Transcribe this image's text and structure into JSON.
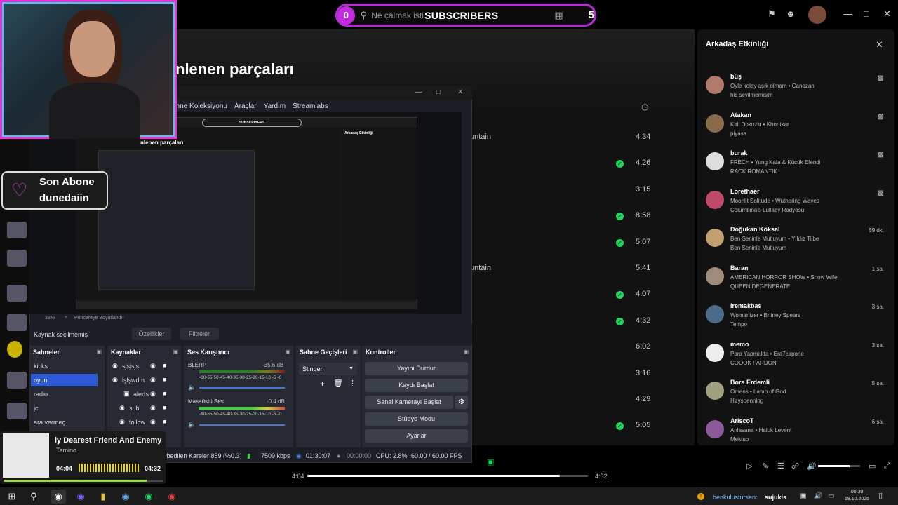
{
  "topbar": {
    "sub_count": "0",
    "search_placeholder": "Ne çalmak istiyor",
    "subscribers_label": "SUBSCRIBERS",
    "subscriber_goal": "5"
  },
  "main": {
    "page_title": "nlenen parçaları",
    "tracks": [
      {
        "title": "untain",
        "duration": "4:34",
        "saved": false
      },
      {
        "title": "",
        "duration": "4:26",
        "saved": true
      },
      {
        "title": "",
        "duration": "3:15",
        "saved": false
      },
      {
        "title": "",
        "duration": "8:58",
        "saved": true
      },
      {
        "title": "",
        "duration": "5:07",
        "saved": true
      },
      {
        "title": "untain",
        "duration": "5:41",
        "saved": false
      },
      {
        "title": "",
        "duration": "4:07",
        "saved": true
      },
      {
        "title": "",
        "duration": "4:32",
        "saved": true
      },
      {
        "title": "",
        "duration": "6:02",
        "saved": false
      },
      {
        "title": "",
        "duration": "3:16",
        "saved": false
      },
      {
        "title": "",
        "duration": "4:29",
        "saved": false
      },
      {
        "title": "",
        "duration": "5:05",
        "saved": true
      }
    ]
  },
  "friends": {
    "title": "Arkadaş Etkinliği",
    "items": [
      {
        "name": "büş",
        "song": "Öyle kolay aşık olmam • Canozan",
        "playlist": "hic sevilmemisim",
        "time": "",
        "color": "#b07a6a"
      },
      {
        "name": "Atakan",
        "song": "Kirli Dokuzlu • Khontkar",
        "playlist": "piyasa",
        "time": "",
        "color": "#8a6a4a"
      },
      {
        "name": "burak",
        "song": "FRECH • Yung Kafa & Kücük Efendi",
        "playlist": "RACK ROMANTIK",
        "time": "",
        "color": "#dddddd"
      },
      {
        "name": "Lorethaer",
        "song": "Moonlit Solitude • Wuthering Waves",
        "playlist": "Columbina's Lullaby Radyosu",
        "time": "",
        "color": "#c04a6a"
      },
      {
        "name": "Doğukan Köksal",
        "song": "Ben Seninle Mutluyum • Yıldız Tilbe",
        "playlist": "Ben Seninle Mutluyum",
        "time": "59 dk.",
        "color": "#c0a070"
      },
      {
        "name": "Baran",
        "song": "AMERICAN HORROR SHOW • Snow Wife",
        "playlist": "QUEEN DEGENERATE",
        "time": "1 sa.",
        "color": "#a08a7a"
      },
      {
        "name": "iremakbas",
        "song": "Womanizer • Britney Spears",
        "playlist": "Tempo",
        "time": "3 sa.",
        "color": "#4a6a8a"
      },
      {
        "name": "memo",
        "song": "Para Yapmakta • Era7capone",
        "playlist": "COOOK PARDON",
        "time": "3 sa.",
        "color": "#eeeeee"
      },
      {
        "name": "Bora Erdemli",
        "song": "Omens • Lamb of God",
        "playlist": "Høyspenning",
        "time": "5 sa.",
        "color": "#a0a080"
      },
      {
        "name": "AriscoT",
        "song": "Anlasana • Haluk Levent",
        "playlist": "Mektup",
        "time": "6 sa.",
        "color": "#8a5a9a"
      }
    ]
  },
  "player": {
    "current_time": "4:04",
    "total_time": "4:32",
    "progress": 0.9,
    "volume": 0.75
  },
  "obs": {
    "menu": [
      "ahne Koleksiyonu",
      "Araçlar",
      "Yardım",
      "Streamlabs"
    ],
    "zoom": "38%",
    "fit_label": "Pencereye Boyutlandır",
    "no_source": "Kaynak seçilmemiş",
    "props_btn": "Özellikler",
    "filters_btn": "Filtreler",
    "docks": {
      "scenes": "Sahneler",
      "sources": "Kaynaklar",
      "mixer": "Ses Karıştırıcı",
      "transitions": "Sahne Geçişleri",
      "controls": "Kontroller"
    },
    "scenes": [
      "kicks",
      "oyun",
      "radio",
      "jc",
      "ara vermeç"
    ],
    "sources": [
      "sjsjsjs",
      "lşlşwdm",
      "alerts",
      "sub",
      "follow"
    ],
    "mixer": [
      {
        "name": "BLERP",
        "db": "-35.6 dB"
      },
      {
        "name": "Masaüstü Ses",
        "db": "-0.4 dB"
      }
    ],
    "scale": "-60-55-50-45-40-35-30-25-20-15-10 -5 -0",
    "transition": "Stinger",
    "controls": [
      "Yayını Durdur",
      "Kaydı Başlat",
      "Sanal Kamerayı Başlat",
      "Stüdyo Modu",
      "Ayarlar"
    ],
    "status": {
      "dropped": "aybedilen Kareler 859 (%0.3)",
      "bitrate": "7509 kbps",
      "live_time": "01:30:07",
      "rec_time": "00:00:00",
      "cpu": "CPU: 2.8%",
      "fps": "60.00 / 60.00 FPS"
    },
    "nested_title": "nlenen parçaları",
    "nested_friends": "Arkadaş Etkinliği"
  },
  "overlay": {
    "sub_line1": "Son Abone",
    "sub_line2": "dunedaiin",
    "np_title": "ly Dearest Friend And Enemy",
    "np_artist": "Tamino",
    "np_current": "04:04",
    "np_total": "04:32",
    "np_progress": 0.9
  },
  "taskbar": {
    "notice_user": "benkulustursen:",
    "notice_text": "sujukis",
    "time": "00:30",
    "date": "18.10.2025"
  }
}
